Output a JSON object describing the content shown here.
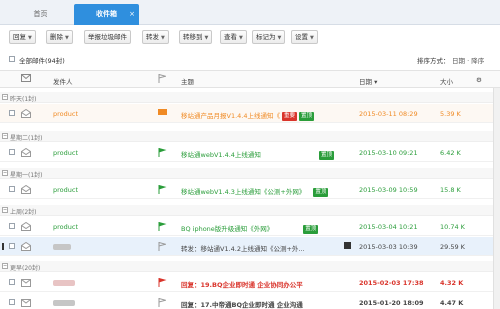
{
  "tabs": {
    "home": "首页",
    "inbox": "收件箱",
    "close": "×"
  },
  "toolbar": {
    "reply": "回复",
    "delete": "删除",
    "report_junk": "举报垃圾邮件",
    "forward": "转发",
    "move_to": "转移到",
    "view": "查看",
    "mark_as": "标记为",
    "settings": "设置"
  },
  "select_all": {
    "label": "全部邮件(94封)",
    "sort_label": "排序方式：",
    "sort_value": "日期 · 降序"
  },
  "columns": {
    "sender": "发件人",
    "subject": "主题",
    "date": "日期",
    "size": "大小"
  },
  "groups": {
    "yesterday": "昨天(1封)",
    "tuesday": "星期二(1封)",
    "monday": "星期一(1封)",
    "last_week": "上周(2封)",
    "earlier": "更早(20封)"
  },
  "rows": [
    {
      "sender": "product",
      "subject": "移站通产品月报V1.4.4上线通知《",
      "tags": [
        "重要",
        "置顶"
      ],
      "date": "2015-03-11 08:29",
      "size": "5.39 K"
    },
    {
      "sender": "product",
      "subject": "移站通webV1.4.4上线通知",
      "tags": [
        "置顶"
      ],
      "date": "2015-03-10 09:21",
      "size": "6.42 K"
    },
    {
      "sender": "product",
      "subject": "移站通webV1.4.3上线通知《公测+外网》",
      "tags": [
        "置顶"
      ],
      "date": "2015-03-09 10:59",
      "size": "15.8 K"
    },
    {
      "sender": "product",
      "subject": "BQ iphone版升级通知《外网》",
      "tags": [
        "置顶"
      ],
      "date": "2015-03-04 10:21",
      "size": "10.74 K"
    },
    {
      "sender": "",
      "subject": "转发：移站通V1.4.2上线通知《公测+外...",
      "tags": [],
      "date": "2015-03-03 10:39",
      "size": "29.59 K"
    },
    {
      "sender": "",
      "subject": "回复：19.BQ企业即时通 企业协同办公平",
      "tags": [],
      "date": "2015-02-03 17:38",
      "size": "4.32 K"
    },
    {
      "sender": "",
      "subject": "回复：17.中帝通BQ企业即时通 企业沟通",
      "tags": [],
      "date": "2015-01-20 18:09",
      "size": "4.47 K"
    }
  ]
}
